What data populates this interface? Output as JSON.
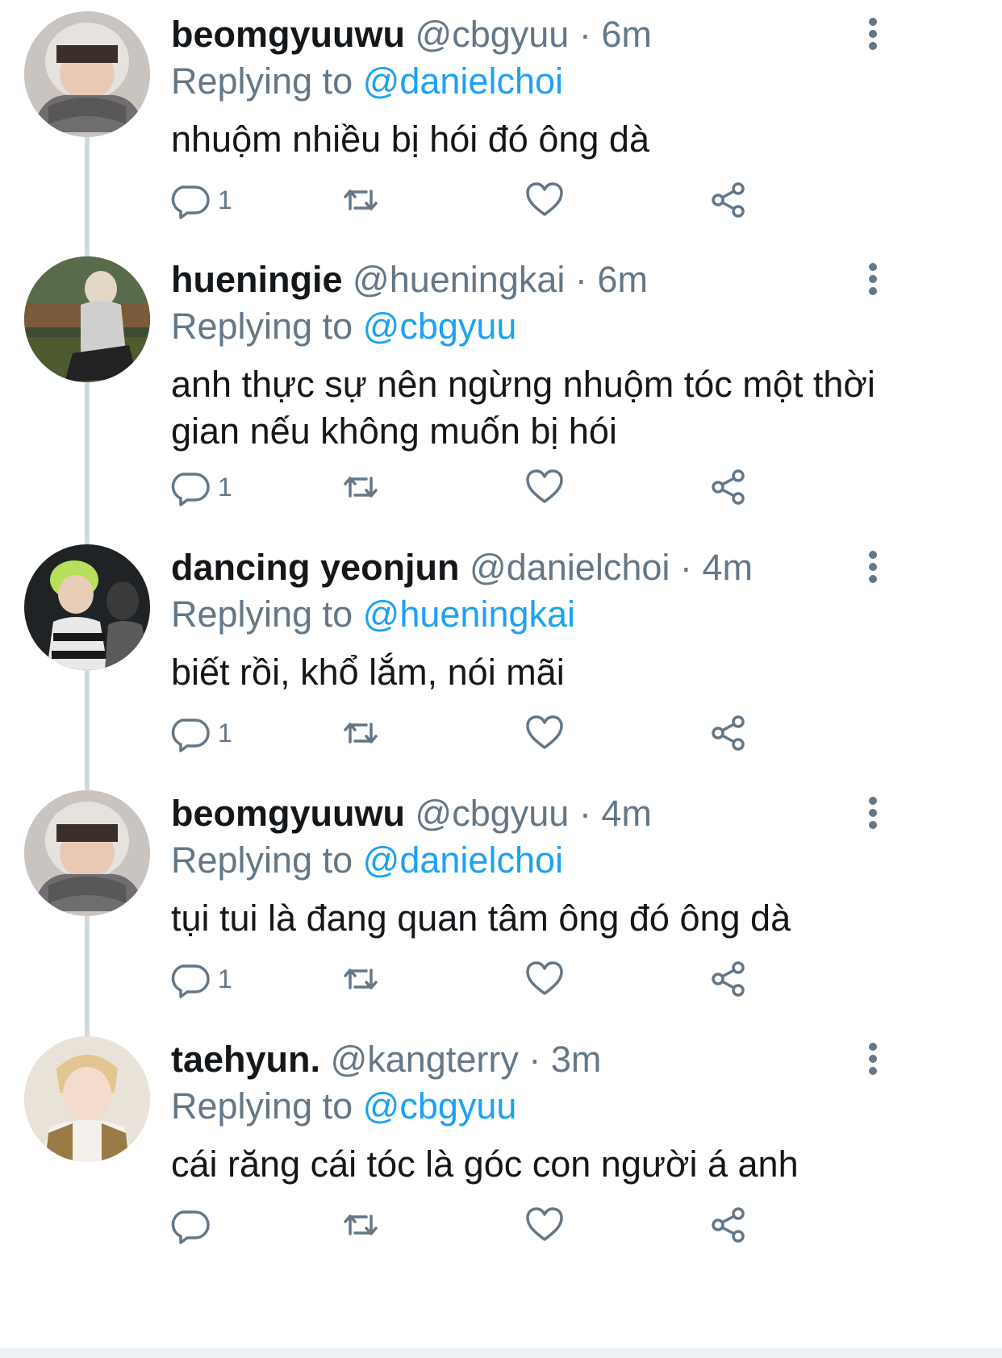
{
  "accent_color": "#1da1f2",
  "muted_color": "#657786",
  "replying_label": "Replying to",
  "tweets": [
    {
      "display_name": "beomgyuuwu",
      "handle": "@cbgyuu",
      "separator": "·",
      "time": "6m",
      "reply_to": "@danielchoi",
      "text": "nhuộm nhiều bị hói đó ông dà",
      "reply_count": "1",
      "avatar": "beomgyu-avatar"
    },
    {
      "display_name": "hueningie",
      "handle": "@hueningkai",
      "separator": "·",
      "time": "6m",
      "reply_to": "@cbgyuu",
      "text": "anh thực sự nên ngừng nhuộm tóc một thời gian nếu không muốn bị hói",
      "reply_count": "1",
      "avatar": "hueningkai-avatar"
    },
    {
      "display_name": "dancing yeonjun",
      "handle": "@danielchoi",
      "separator": "·",
      "time": "4m",
      "reply_to": "@hueningkai",
      "text": "biết rồi, khổ lắm, nói mãi",
      "reply_count": "1",
      "avatar": "yeonjun-avatar"
    },
    {
      "display_name": "beomgyuuwu",
      "handle": "@cbgyuu",
      "separator": "·",
      "time": "4m",
      "reply_to": "@danielchoi",
      "text": "tụi tui là đang quan tâm ông đó ông dà",
      "reply_count": "1",
      "avatar": "beomgyu-avatar"
    },
    {
      "display_name": "taehyun.",
      "handle": "@kangterry",
      "separator": "·",
      "time": "3m",
      "reply_to": "@cbgyuu",
      "text": "cái răng cái tóc là góc con người á anh",
      "reply_count": "",
      "avatar": "taehyun-avatar"
    }
  ],
  "icons": {
    "reply": "reply-bubble-icon",
    "retweet": "retweet-icon",
    "like": "heart-icon",
    "share": "share-icon",
    "more": "more-vertical-icon"
  }
}
